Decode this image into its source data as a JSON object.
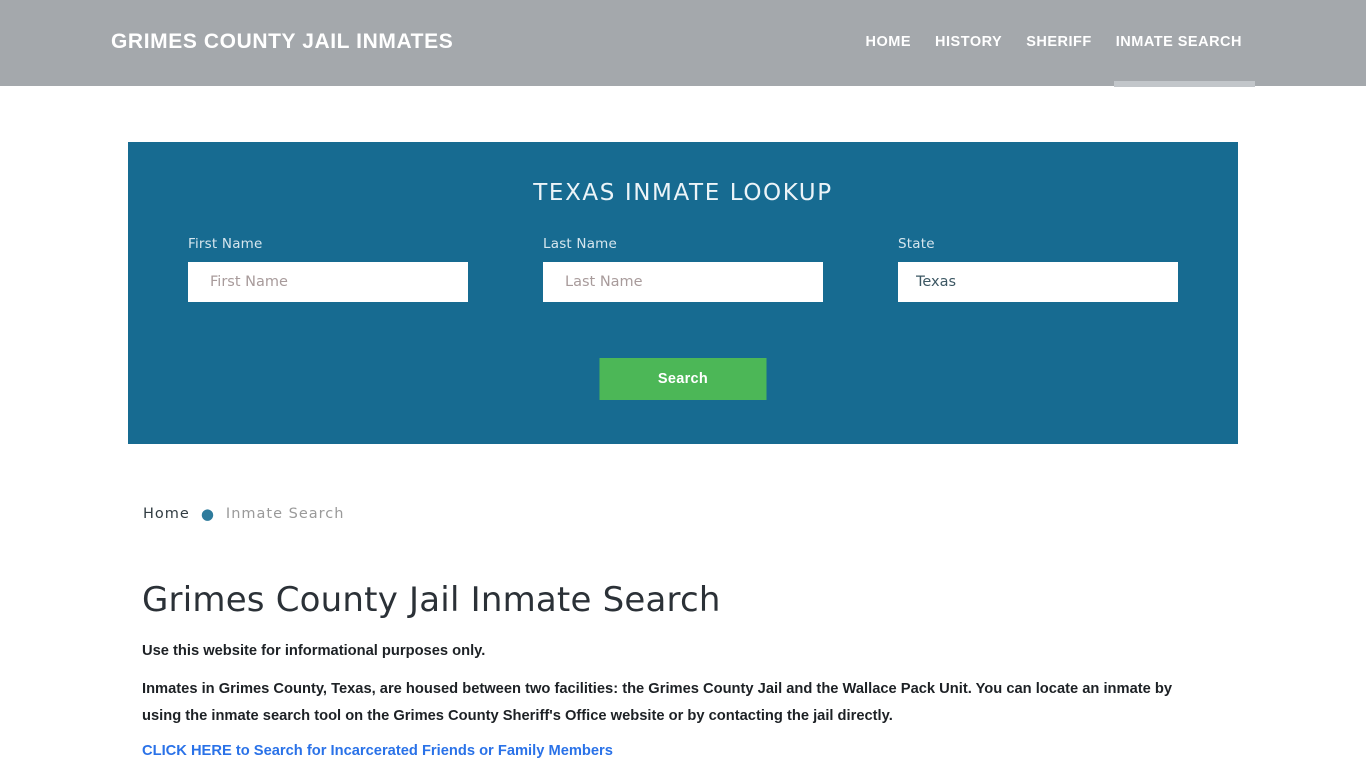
{
  "header": {
    "brand": "GRIMES COUNTY JAIL INMATES",
    "nav": [
      {
        "label": "HOME",
        "active": false
      },
      {
        "label": "HISTORY",
        "active": false
      },
      {
        "label": "SHERIFF",
        "active": false
      },
      {
        "label": "INMATE SEARCH",
        "active": true
      }
    ]
  },
  "search_panel": {
    "title": "TEXAS INMATE LOOKUP",
    "accent_color": "#176b91",
    "button_color": "#4cb757",
    "fields": [
      {
        "label": "First Name",
        "placeholder": "First Name",
        "value": ""
      },
      {
        "label": "Last Name",
        "placeholder": "Last Name",
        "value": ""
      },
      {
        "label": "State",
        "value": "Texas"
      }
    ],
    "state_options": [
      "Texas"
    ],
    "submit_label": "Search"
  },
  "breadcrumb": {
    "home": "Home",
    "separator": "●",
    "current": "Inmate Search"
  },
  "content": {
    "page_title": "Grimes County Jail Inmate Search",
    "paragraph_1": "Use this website for informational purposes only.",
    "paragraph_2": "Inmates in Grimes County, Texas, are housed between two facilities: the Grimes County Jail and the Wallace Pack Unit. You can locate an inmate by using the inmate search tool on the Grimes County Sheriff's Office website or by contacting the jail directly.",
    "link_text": "CLICK HERE to Search for Incarcerated Friends or Family Members",
    "link_color": "#2a72e8"
  }
}
